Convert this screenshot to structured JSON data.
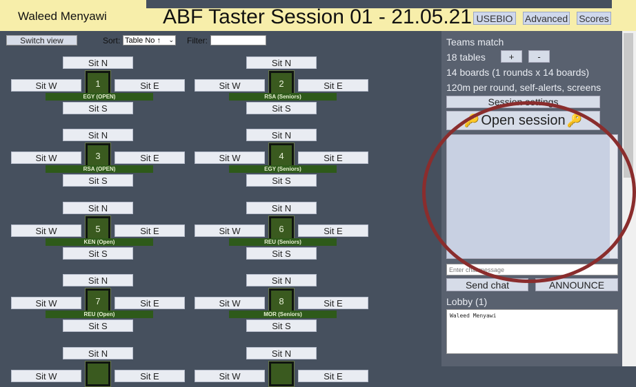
{
  "header": {
    "user_name": "Waleed Menyawi",
    "session_title": "ABF Taster Session 01 - 21.05.21",
    "buttons": [
      "USEBIO",
      "Advanced",
      "Scores"
    ]
  },
  "toolbar": {
    "switch_view_label": "Switch view",
    "sort_label": "Sort:",
    "sort_value": "Table No ↑",
    "filter_label": "Filter:",
    "filter_value": ""
  },
  "seat_labels": {
    "north": "Sit N",
    "south": "Sit S",
    "west": "Sit W",
    "east": "Sit E"
  },
  "tables": [
    {
      "number": "1",
      "team": "EGY (OPEN)"
    },
    {
      "number": "2",
      "team": "RSA (Seniors)"
    },
    {
      "number": "3",
      "team": "RSA (OPEN)"
    },
    {
      "number": "4",
      "team": "EGY (Seniors)"
    },
    {
      "number": "5",
      "team": "KEN (Open)"
    },
    {
      "number": "6",
      "team": "REU (Seniors)"
    },
    {
      "number": "7",
      "team": "REU (Open)"
    },
    {
      "number": "8",
      "team": "MOR (Seniors)"
    },
    {
      "number": "",
      "team": ""
    },
    {
      "number": "",
      "team": ""
    }
  ],
  "panel": {
    "match_type": "Teams match",
    "tables_count": "18 tables",
    "plus_label": "+",
    "minus_label": "-",
    "boards_info": "14 boards (1 rounds x 14 boards)",
    "round_info": "120m per round, self-alerts, screens",
    "session_settings_label": "Session settings",
    "open_session_label": "Open session",
    "chat_placeholder": "Enter chat message",
    "send_chat_label": "Send chat",
    "announce_label": "ANNOUNCE",
    "lobby_title": "Lobby (1)",
    "lobby_users": [
      "Waleed Menyawi"
    ]
  },
  "colors": {
    "header_bg": "#f7eeaa",
    "page_bg": "#46505e",
    "table_label_bg": "#2e5a1a",
    "annotation_circle": "#8a2d2d"
  },
  "icons": {
    "key": "key-icon"
  }
}
